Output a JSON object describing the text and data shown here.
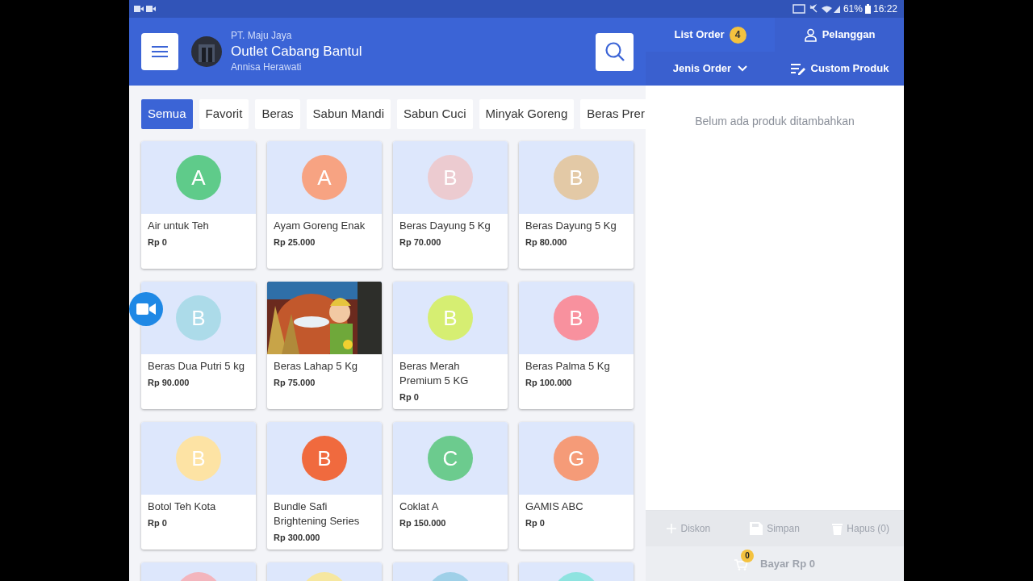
{
  "status_bar": {
    "battery": "61%",
    "time": "16:22"
  },
  "header": {
    "company": "PT. Maju Jaya",
    "outlet": "Outlet Cabang Bantul",
    "user": "Annisa Herawati",
    "list_order": {
      "label": "List Order",
      "count": "4"
    },
    "customer": "Pelanggan",
    "order_type": "Jenis Order",
    "custom_product": "Custom Produk"
  },
  "categories": [
    {
      "label": "Semua",
      "selected": true
    },
    {
      "label": "Favorit",
      "selected": false
    },
    {
      "label": "Beras",
      "selected": false
    },
    {
      "label": "Sabun Mandi",
      "selected": false
    },
    {
      "label": "Sabun Cuci",
      "selected": false
    },
    {
      "label": "Minyak Goreng",
      "selected": false
    },
    {
      "label": "Beras Prer",
      "selected": false
    }
  ],
  "products": [
    {
      "kind": "letter",
      "letter": "A",
      "color": "#5fcb8a",
      "name": "Air untuk Teh",
      "price": "Rp 0"
    },
    {
      "kind": "letter",
      "letter": "A",
      "color": "#f7a382",
      "name": "Ayam Goreng Enak",
      "price": "Rp 25.000"
    },
    {
      "kind": "letter",
      "letter": "B",
      "color": "#eccbd0",
      "name": "Beras Dayung 5 Kg",
      "price": "Rp 70.000"
    },
    {
      "kind": "letter",
      "letter": "B",
      "color": "#e3c9a6",
      "name": "Beras Dayung 5 Kg",
      "price": "Rp 80.000"
    },
    {
      "kind": "letter",
      "letter": "B",
      "color": "#acdbe9",
      "name": "Beras Dua Putri 5 kg",
      "price": "Rp 90.000"
    },
    {
      "kind": "picture",
      "name": "Beras Lahap 5 Kg",
      "price": "Rp 75.000"
    },
    {
      "kind": "letter",
      "letter": "B",
      "color": "#d6ee72",
      "name": "Beras Merah Premium 5 KG",
      "price": "Rp 0"
    },
    {
      "kind": "letter",
      "letter": "B",
      "color": "#f8919e",
      "name": "Beras Palma 5 Kg",
      "price": "Rp 100.000"
    },
    {
      "kind": "letter",
      "letter": "B",
      "color": "#fde3a4",
      "name": "Botol Teh Kota",
      "price": "Rp 0"
    },
    {
      "kind": "letter",
      "letter": "B",
      "color": "#f06a3e",
      "name": "Bundle Safi Brightening Series",
      "price": "Rp 300.000"
    },
    {
      "kind": "letter",
      "letter": "C",
      "color": "#6ccb8e",
      "name": "Coklat A",
      "price": "Rp 150.000"
    },
    {
      "kind": "letter",
      "letter": "G",
      "color": "#f59b78",
      "name": "GAMIS ABC",
      "price": "Rp 0"
    },
    {
      "kind": "partial",
      "color": "#f3b5bd"
    },
    {
      "kind": "partial",
      "color": "#f6e7a0"
    },
    {
      "kind": "partial",
      "color": "#9fd0e8"
    },
    {
      "kind": "partial",
      "color": "#8ee3e0"
    }
  ],
  "cart": {
    "empty_message": "Belum ada produk ditambahkan",
    "actions": [
      {
        "label": "Diskon",
        "disabled": true
      },
      {
        "label": "Simpan",
        "disabled": true
      },
      {
        "label": "Hapus (0)",
        "disabled": true
      }
    ],
    "pay": {
      "count": "0",
      "label": "Bayar Rp 0",
      "disabled": true
    }
  }
}
